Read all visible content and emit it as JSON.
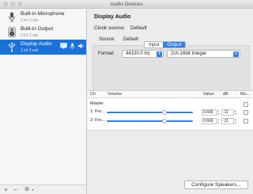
{
  "window": {
    "title": "Audio Devices"
  },
  "sidebar": {
    "devices": [
      {
        "name": "Built-in Microphone",
        "io": "2 in/ 0 out",
        "icon": "microphone-icon",
        "selected": false
      },
      {
        "name": "Built-in Output",
        "io": "0 in/ 2 out",
        "icon": "speaker-icon",
        "selected": false
      },
      {
        "name": "Display Audio",
        "io": "1 in/ 2 out",
        "icon": "usb-icon",
        "selected": true
      }
    ],
    "add_label": "+",
    "remove_label": "–",
    "settings_label": "⚙"
  },
  "detail": {
    "title": "Display Audio",
    "clock_label": "Clock source:",
    "clock_value": "Default",
    "tabs": [
      "Input",
      "Output"
    ],
    "active_tab": "Output",
    "source_label": "Source:",
    "source_value": "Default",
    "format_label": "Format:",
    "sample_rate": "44100.0 Hz",
    "bit_format": "2ch-16bit Integer"
  },
  "table": {
    "headers": [
      "Ch",
      "Volume",
      "Value",
      "dB",
      "Mu..."
    ],
    "rows": [
      {
        "ch": "Master",
        "value": "",
        "db": "",
        "has_slider": false
      },
      {
        "ch": "1: Fro...",
        "value": "0.666",
        "db": "-11",
        "has_slider": true,
        "volume": 0.666
      },
      {
        "ch": "2: Fro...",
        "value": "0.666",
        "db": "-11",
        "has_slider": true,
        "volume": 0.666
      }
    ]
  },
  "footer": {
    "configure_label": "Configure Speakers..."
  },
  "colors": {
    "accent": "#2f7ff0",
    "selection": "#1a72d9"
  }
}
